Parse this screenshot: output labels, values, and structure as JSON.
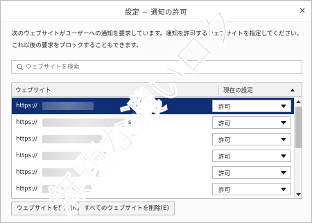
{
  "dialog": {
    "title": "設定 − 通知の許可",
    "close_glyph": "×"
  },
  "description": "次のウェブサイトがユーザーへの通知を要求しています。通知を許可するウェブサイトを指定してください。これ以後の要求をブロックすることもできます。",
  "search": {
    "placeholder": "ウェブサイトを検索"
  },
  "table": {
    "columns": [
      "ウェブサイト",
      "現在の設定"
    ],
    "rows": [
      {
        "url_prefix": "https://",
        "suffix": "",
        "status": "許可",
        "selected": true
      },
      {
        "url_prefix": "https://",
        "suffix": "s",
        "status": "許可",
        "selected": false
      },
      {
        "url_prefix": "https://",
        "suffix": "",
        "status": "許可",
        "selected": false
      },
      {
        "url_prefix": "https://",
        "suffix": "",
        "status": "許可",
        "selected": false
      },
      {
        "url_prefix": "https://",
        "suffix": "",
        "status": "許可",
        "selected": false
      },
      {
        "url_prefix": "https://",
        "suffix": "",
        "status": "許可",
        "selected": false
      }
    ]
  },
  "buttons": {
    "remove_site": "ウェブサイトを削除(R)",
    "remove_all": "すべてのウェブサイトを削除(E)"
  },
  "watermark_text": "無題な濃いログ",
  "colors": {
    "selected_row": "#0f2f75",
    "watermark": "#bdbdbd"
  }
}
